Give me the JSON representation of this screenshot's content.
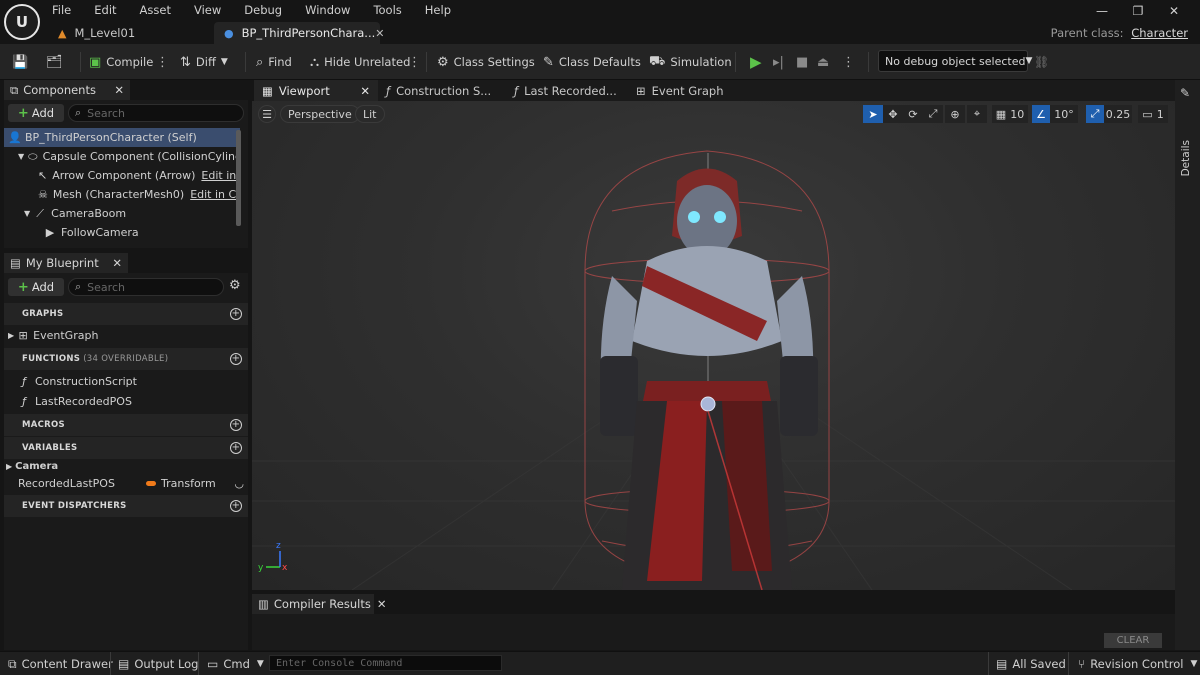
{
  "menu": [
    "File",
    "Edit",
    "Asset",
    "View",
    "Debug",
    "Window",
    "Tools",
    "Help"
  ],
  "tabs": {
    "level": "M_Level01",
    "blueprint": "BP_ThirdPersonChara..."
  },
  "parent_class": {
    "label": "Parent class:",
    "value": "Character"
  },
  "toolbar": {
    "compile": "Compile",
    "diff": "Diff",
    "find": "Find",
    "hide_unrelated": "Hide Unrelated",
    "class_settings": "Class Settings",
    "class_defaults": "Class Defaults",
    "simulation": "Simulation",
    "debug_object": "No debug object selected"
  },
  "components": {
    "title": "Components",
    "add": "Add",
    "search_placeholder": "Search",
    "tree": [
      {
        "label": "BP_ThirdPersonCharacter (Self)"
      },
      {
        "label": "Capsule Component (CollisionCylinder"
      },
      {
        "label": "Arrow Component (Arrow)",
        "edit": "Edit in C+"
      },
      {
        "label": "Mesh (CharacterMesh0)",
        "edit": "Edit in C++"
      },
      {
        "label": "CameraBoom"
      },
      {
        "label": "FollowCamera"
      }
    ]
  },
  "my_blueprint": {
    "title": "My Blueprint",
    "add": "Add",
    "search_placeholder": "Search",
    "graphs_header": "GRAPHS",
    "graphs": [
      "EventGraph"
    ],
    "functions_header": "FUNCTIONS",
    "functions_sub": "(34 OVERRIDABLE)",
    "functions": [
      "ConstructionScript",
      "LastRecordedPOS"
    ],
    "macros_header": "MACROS",
    "variables_header": "VARIABLES",
    "variable_category": "Camera",
    "variable_name": "RecordedLastPOS",
    "variable_type": "Transform",
    "dispatchers_header": "EVENT DISPATCHERS"
  },
  "viewport_tabs": [
    "Viewport",
    "Construction S...",
    "Last Recorded...",
    "Event Graph"
  ],
  "viewport": {
    "perspective": "Perspective",
    "lit": "Lit",
    "grid_snap": "10",
    "rotation_snap": "10°",
    "scale_snap": "0.25",
    "camera_speed": "1"
  },
  "details_label": "Details",
  "compiler": {
    "tab": "Compiler Results",
    "clear": "CLEAR"
  },
  "statusbar": {
    "content_drawer": "Content Drawer",
    "output_log": "Output Log",
    "cmd": "Cmd",
    "console_placeholder": "Enter Console Command",
    "all_saved": "All Saved",
    "revision_control": "Revision Control"
  },
  "colors": {
    "accent_blue": "#1f5fae",
    "play_green": "#5cc24a",
    "transform_orange": "#f07a1a",
    "selection": "#3a4d6e"
  }
}
